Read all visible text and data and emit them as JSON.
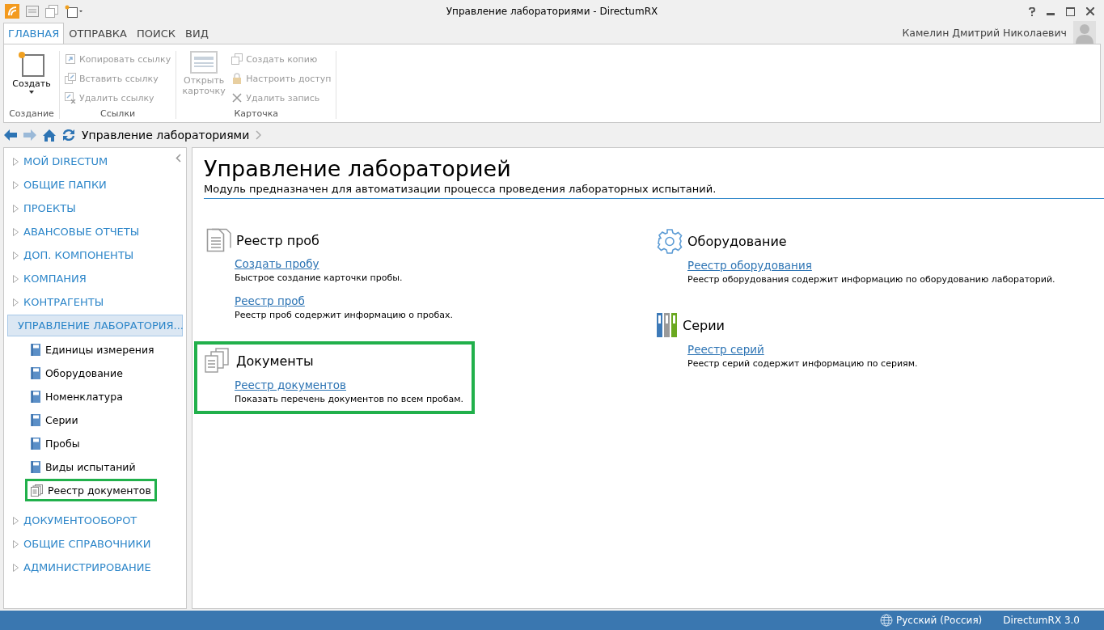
{
  "window": {
    "title": "Управление лабораториями - DirectumRX"
  },
  "tabs": [
    {
      "label": "ГЛАВНАЯ",
      "selected": true
    },
    {
      "label": "ОТПРАВКА",
      "selected": false
    },
    {
      "label": "ПОИСК",
      "selected": false
    },
    {
      "label": "ВИД",
      "selected": false
    }
  ],
  "user": {
    "name": "Камелин Дмитрий Николаевич"
  },
  "ribbon": [
    {
      "label": "Создание",
      "items": [
        {
          "kind": "large",
          "label": "Создать",
          "disabled": false,
          "dropdown": true
        }
      ]
    },
    {
      "label": "Ссылки",
      "items": [
        {
          "kind": "small",
          "label": "Копировать ссылку",
          "disabled": true
        },
        {
          "kind": "small",
          "label": "Вставить ссылку",
          "disabled": true
        },
        {
          "kind": "small",
          "label": "Удалить ссылку",
          "disabled": true
        }
      ]
    },
    {
      "label": "Карточка",
      "items": [
        {
          "kind": "large",
          "label": "Открыть карточку",
          "disabled": true
        },
        {
          "kind": "small",
          "label": "Создать копию",
          "disabled": true
        },
        {
          "kind": "small",
          "label": "Настроить доступ",
          "disabled": true
        },
        {
          "kind": "small",
          "label": "Удалить запись",
          "disabled": true
        }
      ]
    }
  ],
  "breadcrumb": [
    "Управление лабораториями"
  ],
  "sidebar": {
    "items": [
      {
        "label": "МОЙ DIRECTUM",
        "expanded": false,
        "selected": false
      },
      {
        "label": "ОБЩИЕ ПАПКИ",
        "expanded": false,
        "selected": false
      },
      {
        "label": "ПРОЕКТЫ",
        "expanded": false,
        "selected": false
      },
      {
        "label": "АВАНСОВЫЕ ОТЧЕТЫ",
        "expanded": false,
        "selected": false
      },
      {
        "label": "ДОП. КОМПОНЕНТЫ",
        "expanded": false,
        "selected": false
      },
      {
        "label": "КОМПАНИЯ",
        "expanded": false,
        "selected": false
      },
      {
        "label": "КОНТРАГЕНТЫ",
        "expanded": false,
        "selected": false
      },
      {
        "label": "УПРАВЛЕНИЕ ЛАБОРАТОРИЯ...",
        "expanded": true,
        "selected": true,
        "children": [
          {
            "label": "Единицы измерения",
            "kind": "reference",
            "highlighted": false
          },
          {
            "label": "Оборудование",
            "kind": "reference",
            "highlighted": false
          },
          {
            "label": "Номенклатура",
            "kind": "reference",
            "highlighted": false
          },
          {
            "label": "Серии",
            "kind": "reference",
            "highlighted": false
          },
          {
            "label": "Пробы",
            "kind": "reference",
            "highlighted": false
          },
          {
            "label": "Виды испытаний",
            "kind": "reference",
            "highlighted": false
          },
          {
            "label": "Реестр документов",
            "kind": "documents",
            "highlighted": true
          }
        ]
      },
      {
        "label": "ДОКУМЕНТООБОРОТ",
        "expanded": false,
        "selected": false
      },
      {
        "label": "ОБЩИЕ СПРАВОЧНИКИ",
        "expanded": false,
        "selected": false
      },
      {
        "label": "АДМИНИСТРИРОВАНИЕ",
        "expanded": false,
        "selected": false
      }
    ]
  },
  "content": {
    "title": "Управление лабораторией",
    "description": "Модуль предназначен для автоматизации процесса проведения лабораторных испытаний.",
    "columns": [
      [
        {
          "kind": "list",
          "title": "Реестр проб",
          "highlighted": false,
          "links": [
            {
              "label": "Создать пробу",
              "description": "Быстрое создание карточки пробы."
            },
            {
              "label": "Реестр проб",
              "description": "Реестр проб содержит информацию о пробах."
            }
          ]
        },
        {
          "kind": "documents",
          "title": "Документы",
          "highlighted": true,
          "links": [
            {
              "label": "Реестр документов",
              "description": "Показать перечень документов по всем пробам."
            }
          ]
        }
      ],
      [
        {
          "kind": "gear",
          "title": "Оборудование",
          "highlighted": false,
          "links": [
            {
              "label": "Реестр оборудования",
              "description": "Реестр оборудования содержит информацию по оборудованию лабораторий."
            }
          ]
        },
        {
          "kind": "binders",
          "title": "Серии",
          "highlighted": false,
          "links": [
            {
              "label": "Реестр серий",
              "description": "Реестр серий содержит информацию по сериям."
            }
          ]
        }
      ]
    ]
  },
  "status_bar": {
    "language": "Русский (Россия)",
    "version": "DirectumRX 3.0"
  }
}
